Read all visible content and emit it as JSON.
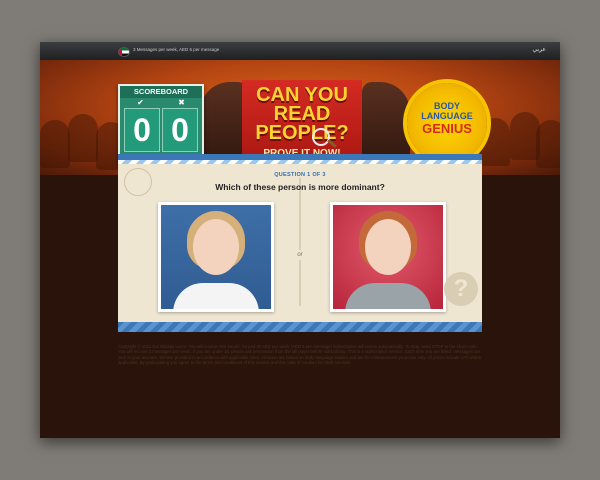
{
  "topbar": {
    "pricing_text": "3 Messages per week, AED 5 per message",
    "language_link": "عربي"
  },
  "scoreboard": {
    "title": "SCOREBOARD",
    "correct_symbol": "✔",
    "wrong_symbol": "✖",
    "correct_count": "0",
    "wrong_count": "0"
  },
  "banner": {
    "headline": "CAN YOU READ PEOPLE?",
    "cta": "PROVE IT NOW!"
  },
  "badge": {
    "line1": "BODY",
    "line2": "LANGUAGE",
    "line3": "GENIUS"
  },
  "quiz": {
    "progress": "QUESTION 1 OF 3",
    "question": "Which of these person is more dominant?",
    "separator": "or"
  },
  "footer": {
    "legal_text": "Copyright © 2011 Du/ Etisalat users: You will receive 300 emails, for just 30 AED per week (AED 5 per message) Subscription will renew automatically. To stop, send STOP to the short code. You will receive 3 messages per week. If you are under 18, please ask permission from the bill payer before subscribing. This is a subscription service. Each time you are billed, messages are sent to your account. Service provided in accordance with applicable rules. Answers are based on body language studies and are for entertainment purposes only. All prices include VAT where applicable. By participating you agree to the terms and conditions of this service and the code of conduct for SMS services."
  },
  "colors": {
    "accent_blue": "#3c78b8",
    "banner_red": "#c9231b",
    "headline_yellow": "#ffd432",
    "scoreboard_green": "#2a8a6e"
  }
}
